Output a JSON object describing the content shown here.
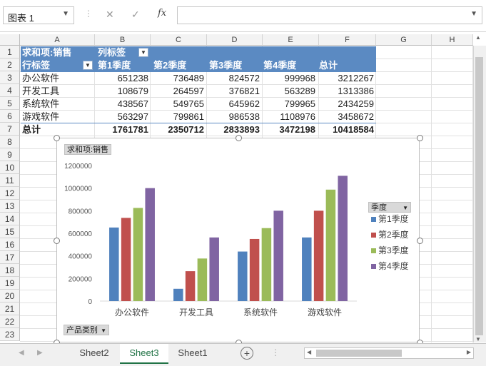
{
  "formula_bar": {
    "name_box": "图表 1",
    "cancel_glyph": "✕",
    "enter_glyph": "✓",
    "fx_label": "fx",
    "formula": ""
  },
  "grid": {
    "columns": [
      "A",
      "B",
      "C",
      "D",
      "E",
      "F",
      "G",
      "H"
    ],
    "rows": [
      "1",
      "2",
      "3",
      "4",
      "5",
      "6",
      "7",
      "8",
      "9",
      "10",
      "11",
      "12",
      "13",
      "14",
      "15",
      "16",
      "17",
      "18",
      "19",
      "20",
      "21",
      "22",
      "23"
    ]
  },
  "pivot": {
    "value_field": "求和项:销售",
    "column_label": "列标签",
    "row_label": "行标签",
    "quarters": [
      "第1季度",
      "第2季度",
      "第3季度",
      "第4季度"
    ],
    "total_label": "总计",
    "rows": [
      {
        "name": "办公软件",
        "values": [
          "651238",
          "736489",
          "824572",
          "999968"
        ],
        "total": "3212267"
      },
      {
        "name": "开发工具",
        "values": [
          "108679",
          "264597",
          "376821",
          "563289"
        ],
        "total": "1313386"
      },
      {
        "name": "系统软件",
        "values": [
          "438567",
          "549765",
          "645962",
          "799965"
        ],
        "total": "2434259"
      },
      {
        "name": "游戏软件",
        "values": [
          "563297",
          "799861",
          "986538",
          "1108976"
        ],
        "total": "3458672"
      }
    ],
    "grand_total_label": "总计",
    "grand_totals": [
      "1761781",
      "2350712",
      "2833893",
      "3472198",
      "10418584"
    ]
  },
  "chart": {
    "value_field_button": "求和项:销售",
    "legend_field_button": "季度",
    "axis_field_button": "产品类别"
  },
  "chart_data": {
    "type": "bar",
    "categories": [
      "办公软件",
      "开发工具",
      "系统软件",
      "游戏软件"
    ],
    "series": [
      {
        "name": "第1季度",
        "color": "#4f81bd",
        "values": [
          651238,
          108679,
          438567,
          563297
        ]
      },
      {
        "name": "第2季度",
        "color": "#c0504d",
        "values": [
          736489,
          264597,
          549765,
          799861
        ]
      },
      {
        "name": "第3季度",
        "color": "#9bbb59",
        "values": [
          824572,
          376821,
          645962,
          986538
        ]
      },
      {
        "name": "第4季度",
        "color": "#8064a2",
        "values": [
          999968,
          563289,
          799965,
          1108976
        ]
      }
    ],
    "ylim": [
      0,
      1200000
    ],
    "yticks": [
      "0",
      "200000",
      "400000",
      "600000",
      "800000",
      "1000000",
      "1200000"
    ],
    "title": "",
    "xlabel": "",
    "ylabel": "",
    "grid": false,
    "legend": "right"
  },
  "sheets": {
    "tabs": [
      "Sheet2",
      "Sheet3",
      "Sheet1"
    ],
    "active": "Sheet3",
    "add_glyph": "+"
  }
}
